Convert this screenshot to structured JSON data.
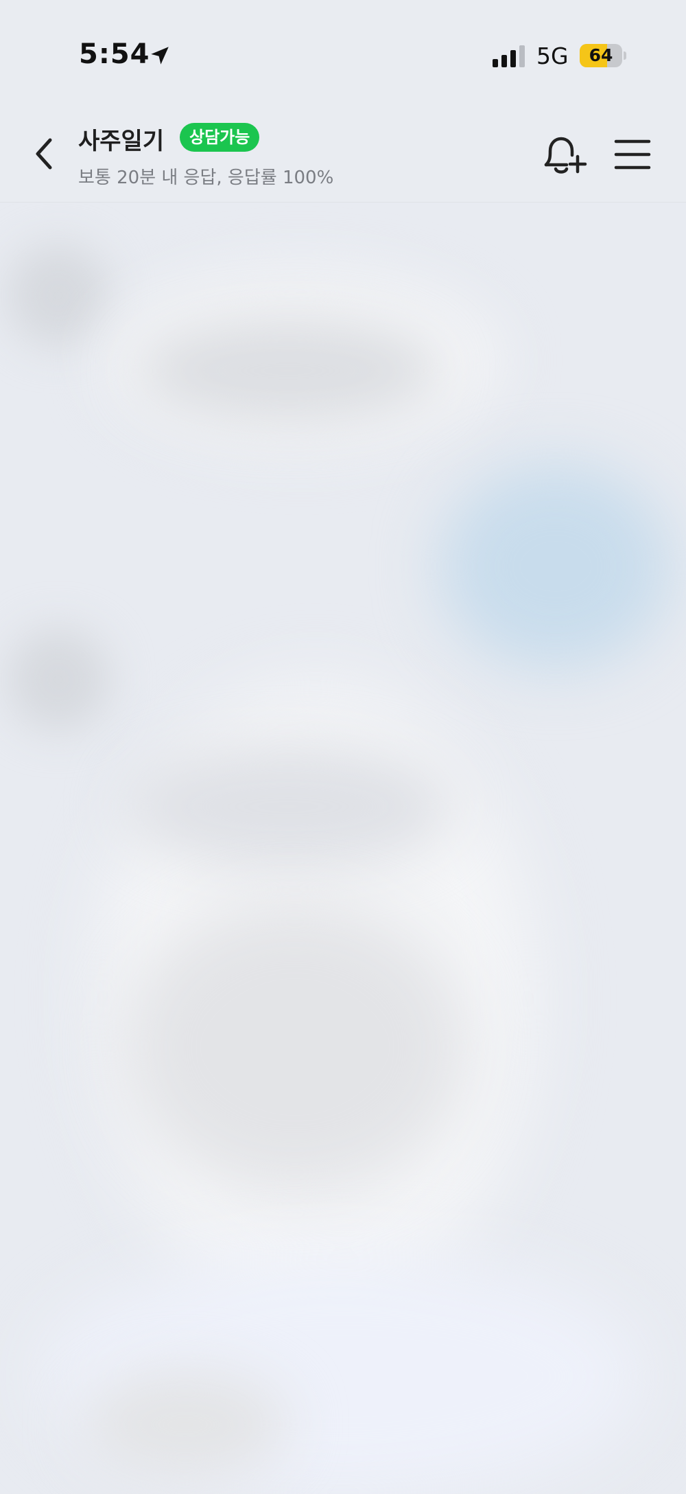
{
  "status_bar": {
    "time": "5:54",
    "network": "5G",
    "battery_percent": "64",
    "battery_level": 0.64,
    "icons": [
      "location-arrow-icon",
      "cellular-signal-icon",
      "battery-icon"
    ]
  },
  "header": {
    "title": "사주일기",
    "badge": "상담가능",
    "subtitle": "보통 20분 내 응답, 응답률 100%",
    "badge_color": "#1bc54f",
    "icons": [
      "back-chevron-icon",
      "bell-plus-icon",
      "hamburger-menu-icon"
    ]
  },
  "colors": {
    "background": "#e9ecf1",
    "title_text": "#1f1f1f",
    "subtitle_text": "#7a7d83"
  }
}
